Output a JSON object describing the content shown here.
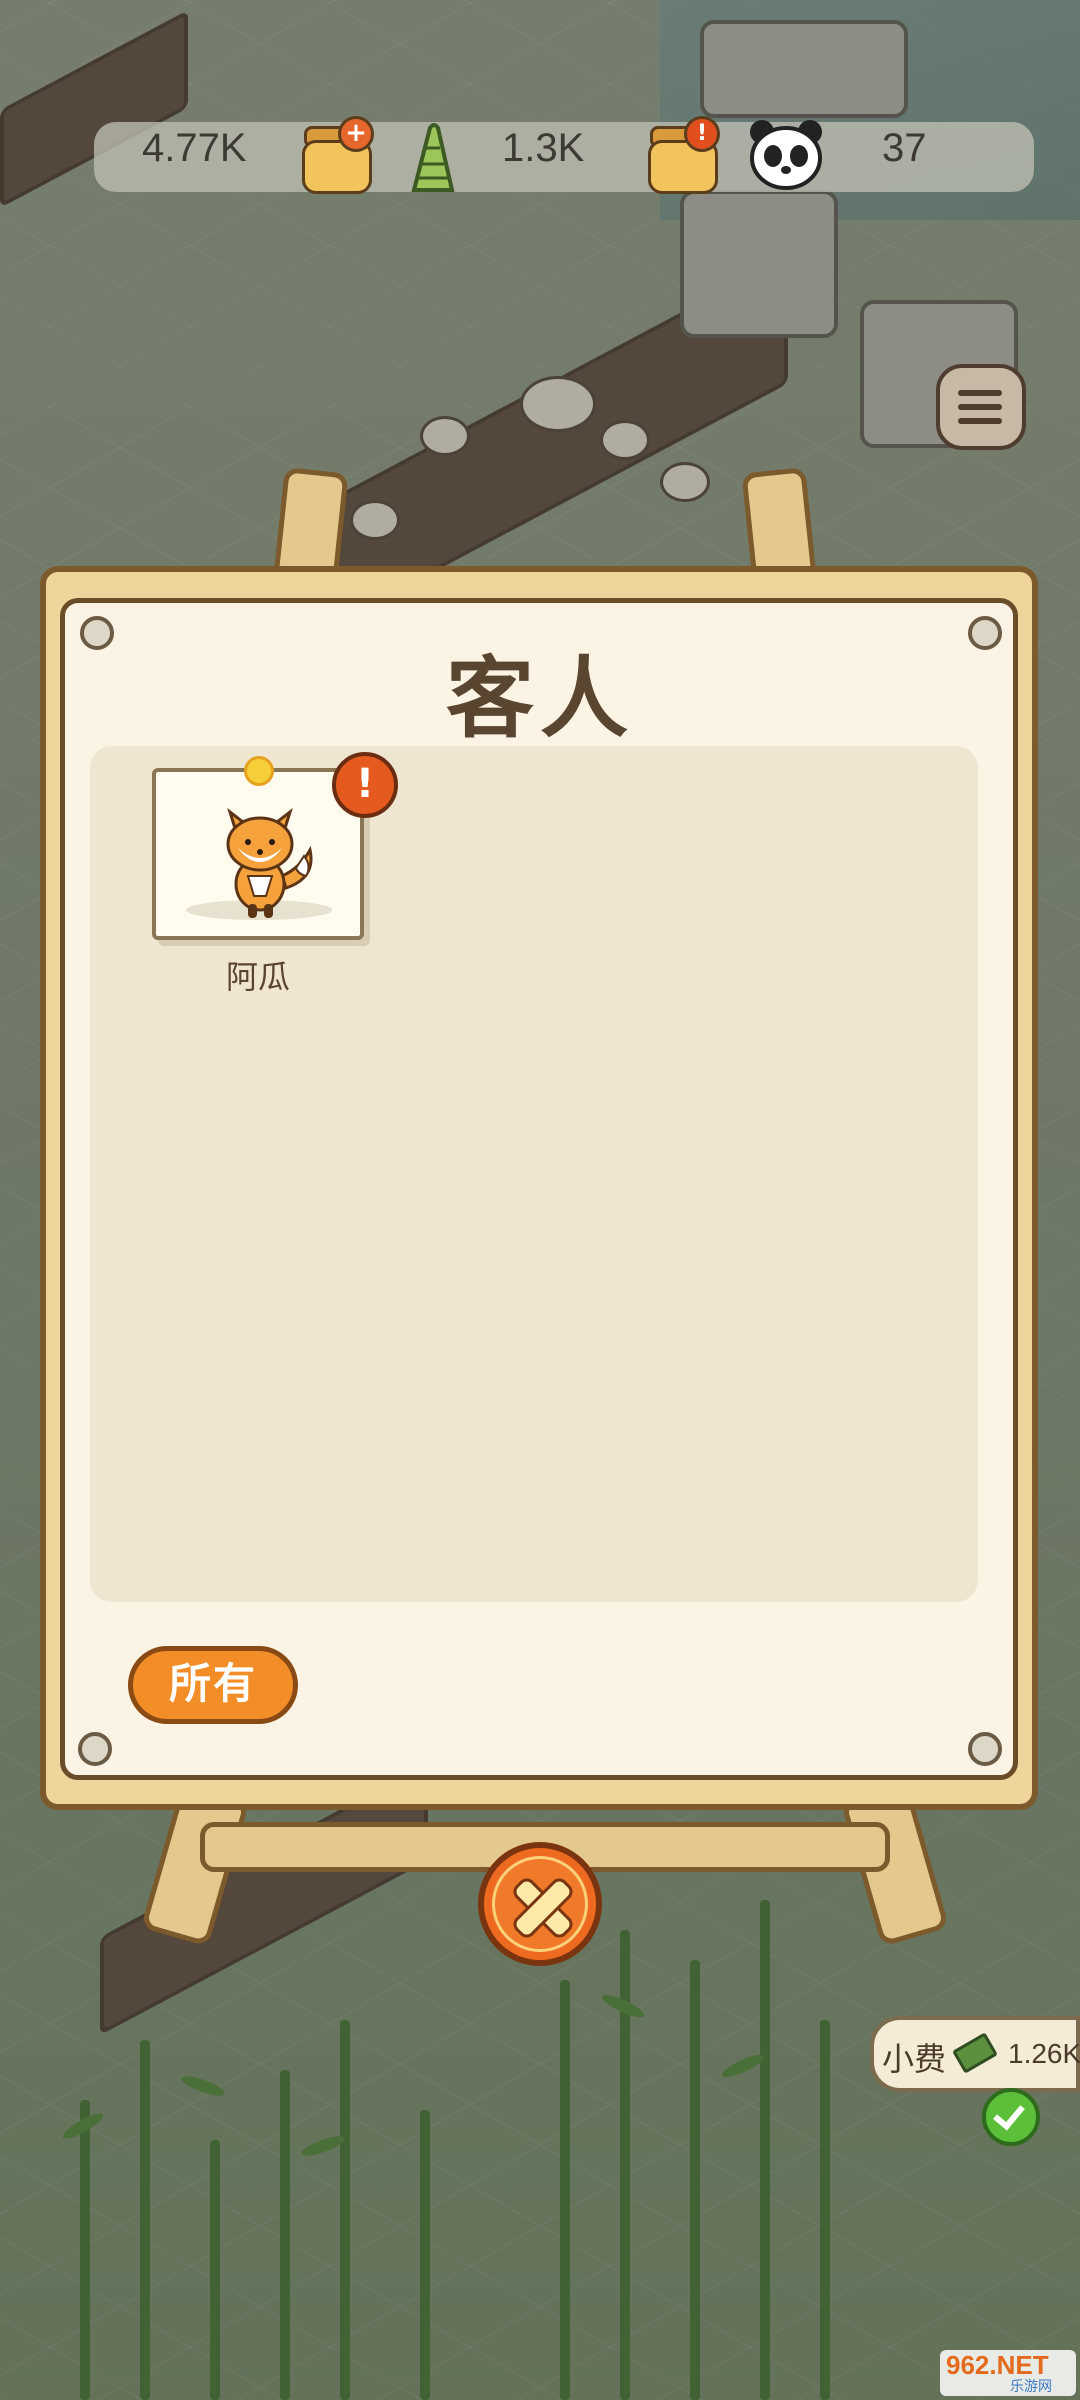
{
  "resources": {
    "honey_value": "4.77K",
    "bamboo_value": "1.3K",
    "panda_value": "37",
    "honey_icon": "honey-jar-icon",
    "bamboo_icon": "bamboo-shoot-icon",
    "special_jar_icon": "honey-jar-alert-icon",
    "panda_icon": "panda-icon"
  },
  "panel": {
    "title": "客人",
    "guests": [
      {
        "name": "阿瓜",
        "avatar": "fox-icon",
        "has_alert": true,
        "alert_symbol": "!"
      }
    ],
    "filter_button": "所有",
    "close_icon": "close-icon"
  },
  "tip": {
    "label": "小费",
    "value": "1.26K"
  },
  "watermark": {
    "main": "962.NET",
    "sub": "乐游网"
  },
  "colors": {
    "accent_orange": "#f28d28",
    "board_frame": "#7c5a2c",
    "paper": "#fbf4e4",
    "title_brown": "#5a4530"
  }
}
